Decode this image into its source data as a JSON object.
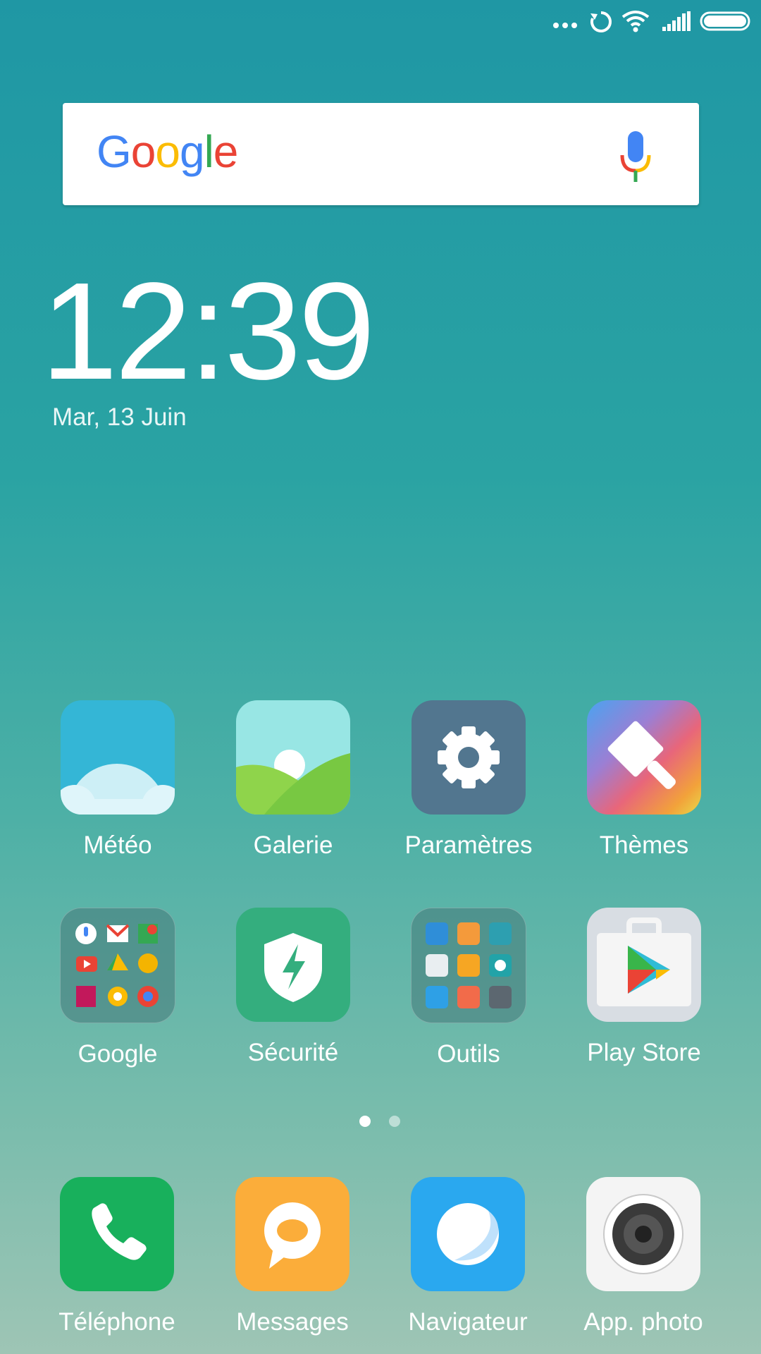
{
  "status_bar": {
    "icons": [
      "more-dots-icon",
      "sync-icon",
      "wifi-icon",
      "signal-icon",
      "battery-icon"
    ]
  },
  "search": {
    "logo_text": "Google",
    "logo_letters": [
      {
        "char": "G",
        "color": "#4285F4"
      },
      {
        "char": "o",
        "color": "#EA4335"
      },
      {
        "char": "o",
        "color": "#FBBC05"
      },
      {
        "char": "g",
        "color": "#4285F4"
      },
      {
        "char": "l",
        "color": "#34A853"
      },
      {
        "char": "e",
        "color": "#EA4335"
      }
    ],
    "mic_icon": "microphone-icon"
  },
  "clock": {
    "time": "12:39",
    "date": "Mar, 13 Juin"
  },
  "apps": [
    {
      "label": "Météo",
      "icon": "weather-icon",
      "color": "#34b6d6"
    },
    {
      "label": "Galerie",
      "icon": "gallery-icon",
      "color": "#8fd44b"
    },
    {
      "label": "Paramètres",
      "icon": "settings-gear-icon",
      "color": "#52768f"
    },
    {
      "label": "Thèmes",
      "icon": "themes-brush-icon",
      "color": "#e95b74"
    },
    {
      "label": "Google",
      "icon": "google-folder-icon",
      "color": "#5c8f8f"
    },
    {
      "label": "Sécurité",
      "icon": "security-shield-icon",
      "color": "#34ae7e"
    },
    {
      "label": "Outils",
      "icon": "tools-folder-icon",
      "color": "#5a9494"
    },
    {
      "label": "Play Store",
      "icon": "play-store-icon",
      "color": "#e3e6ea"
    }
  ],
  "pager": {
    "current": 1,
    "total": 2
  },
  "dock": [
    {
      "label": "Téléphone",
      "icon": "phone-icon",
      "color": "#18b05c"
    },
    {
      "label": "Messages",
      "icon": "messages-bubble-icon",
      "color": "#fbad3a"
    },
    {
      "label": "Navigateur",
      "icon": "browser-planet-icon",
      "color": "#2aa8ef"
    },
    {
      "label": "App. photo",
      "icon": "camera-icon",
      "color": "#f4f4f4"
    }
  ]
}
